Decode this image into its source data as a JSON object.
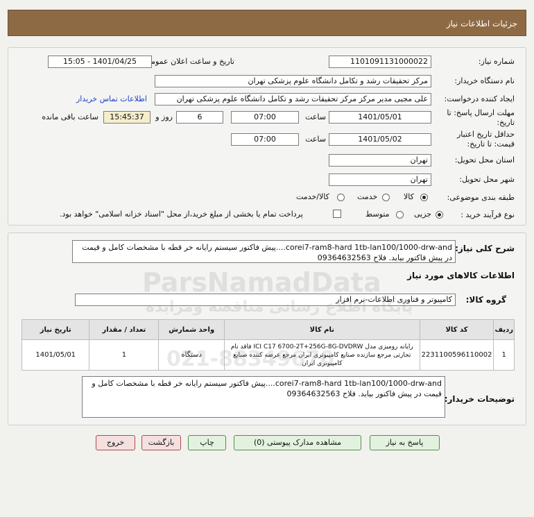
{
  "header": {
    "title": "جزئیات اطلاعات نیاز"
  },
  "form": {
    "need_number_label": "شماره نیاز:",
    "need_number": "1101091131000022",
    "announce_label": "تاریخ و ساعت اعلان عمومی:",
    "announce_value": "1401/04/25 - 15:05",
    "buyer_label": "نام دستگاه خریدار:",
    "buyer_value": "مرکز تحقیقات رشد و تکامل دانشگاه علوم پزشکی تهران",
    "creator_label": "ایجاد کننده درخواست:",
    "creator_value": "علی مجیی مدیر مرکز  مرکز تحقیقات رشد و تکامل دانشگاه علوم پزشکی تهران",
    "contact_link": "اطلاعات تماس خریدار",
    "deadline_label": "مهلت ارسال پاسخ: تا تاریخ:",
    "deadline_date": "1401/05/01",
    "time_label": "ساعت",
    "deadline_time": "07:00",
    "days_value": "6",
    "days_label": "روز و",
    "remaining_value": "15:45:37",
    "remaining_label": "ساعت باقی مانده",
    "validity_label": "حداقل تاریخ اعتبار قیمت: تا تاریخ:",
    "validity_date": "1401/05/02",
    "validity_time": "07:00",
    "province_label": "استان محل تحویل:",
    "province_value": "تهران",
    "city_label": "شهر محل تحویل:",
    "city_value": "تهران",
    "category_label": "طبقه بندی موضوعی:",
    "category_options": [
      "کالا",
      "خدمت",
      "کالا/خدمت"
    ],
    "category_selected": "کالا",
    "process_label": "نوع فرآیند خرید :",
    "process_options": [
      "جزیی",
      "متوسط"
    ],
    "process_selected": "جزیی",
    "treasury_text": "پرداخت تمام یا بخشی از مبلغ خرید،از محل \"اسناد خزانه اسلامی\" خواهد بود."
  },
  "summary": {
    "label": "شرح کلی نیاز:",
    "text": "corei7-ram8-hard 1tb-lan100/1000-drw-and....پیش فاکتور سیستم رایانه خر قطه با مشخصات کامل و قیمت در پیش فاکتور بیاید. فلاح 09364632563"
  },
  "goods": {
    "title": "اطلاعات کالاهای مورد نیاز",
    "group_label": "گروه کالا:",
    "group_value": "کامپیوتر و فناوری اطلاعات-نرم افزار",
    "columns": [
      "ردیف",
      "کد کالا",
      "نام کالا",
      "واحد شمارش",
      "تعداد / مقدار",
      "تاریخ نیاز"
    ],
    "rows": [
      {
        "row": "1",
        "code": "2231100596110002",
        "name": "رایانه رومیزی مدل ICI C17 6700-2T+256G-8G-DVDRW فاقد نام تجارتی مرجع سازنده صنایع کامپیوتری ایران مرجع عرضه کننده صنایع کامپیوتری ایران",
        "unit": "دستگاه",
        "qty": "1",
        "date": "1401/05/01"
      }
    ]
  },
  "buyer_notes": {
    "label": "توضیحات خریدار:",
    "text": "corei7-ram8-hard 1tb-lan100/1000-drw-and....پیش فاکتور سیستم رایانه خر قطه با مشخصات کامل و قیمت در پیش فاکتور بیاید. فلاح 09364632563"
  },
  "buttons": {
    "reply": "پاسخ به نیاز",
    "attachments": "مشاهده مدارک پیوستی (0)",
    "print": "چاپ",
    "back": "بازگشت",
    "exit": "خروج"
  },
  "watermark": {
    "brand": "ParsNamadData",
    "persian": "پایگاه اطلاع رسانی مناقصه ومزایده",
    "phone": "021-88349670"
  }
}
